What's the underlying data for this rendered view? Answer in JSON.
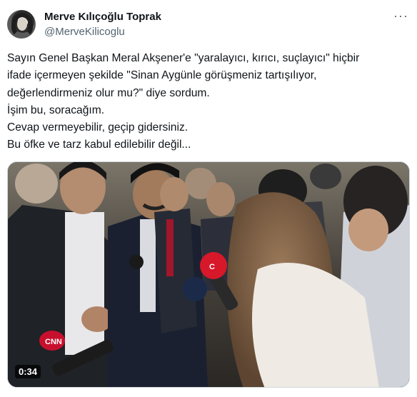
{
  "author": {
    "name": "Merve Kılıçoğlu Toprak",
    "handle": "@MerveKilicoglu"
  },
  "more_icon": "more-horizontal-icon",
  "tweet_lines": [
    "Sayın Genel Başkan Meral Akşener'e \"yaralayıcı, kırıcı, suçlayıcı\" hiçbir",
    "ifade içermeyen şekilde \"Sinan Aygünle görüşmeniz tartışılıyor,",
    "değerlendirmeniz olur mu?\" diye sordum.",
    "İşim bu, soracağım.",
    "Cevap vermeyebilir, geçip gidersiniz.",
    "Bu öfke ve tarz kabul edilebilir değil..."
  ],
  "media": {
    "duration": "0:34",
    "microphone_labels": [
      "CNN",
      "C"
    ]
  },
  "colors": {
    "handle": "#536471",
    "text": "#0f1419",
    "border": "#cfd9de"
  }
}
